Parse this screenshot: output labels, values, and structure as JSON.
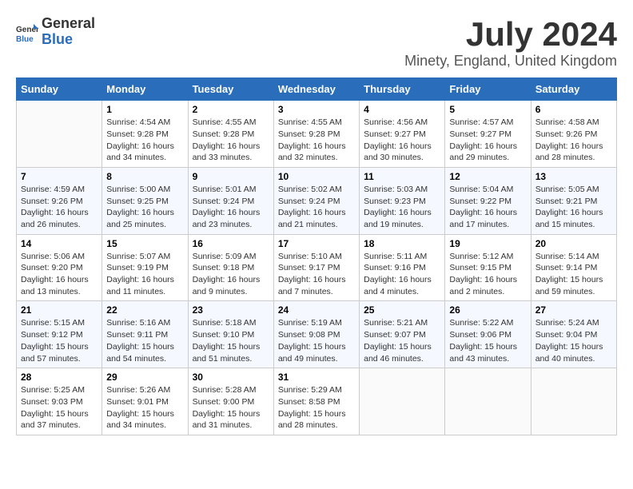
{
  "logo": {
    "general": "General",
    "blue": "Blue"
  },
  "title": "July 2024",
  "location": "Minety, England, United Kingdom",
  "days_header": [
    "Sunday",
    "Monday",
    "Tuesday",
    "Wednesday",
    "Thursday",
    "Friday",
    "Saturday"
  ],
  "weeks": [
    [
      {
        "day": "",
        "sunrise": "",
        "sunset": "",
        "daylight": ""
      },
      {
        "day": "1",
        "sunrise": "Sunrise: 4:54 AM",
        "sunset": "Sunset: 9:28 PM",
        "daylight": "Daylight: 16 hours and 34 minutes."
      },
      {
        "day": "2",
        "sunrise": "Sunrise: 4:55 AM",
        "sunset": "Sunset: 9:28 PM",
        "daylight": "Daylight: 16 hours and 33 minutes."
      },
      {
        "day": "3",
        "sunrise": "Sunrise: 4:55 AM",
        "sunset": "Sunset: 9:28 PM",
        "daylight": "Daylight: 16 hours and 32 minutes."
      },
      {
        "day": "4",
        "sunrise": "Sunrise: 4:56 AM",
        "sunset": "Sunset: 9:27 PM",
        "daylight": "Daylight: 16 hours and 30 minutes."
      },
      {
        "day": "5",
        "sunrise": "Sunrise: 4:57 AM",
        "sunset": "Sunset: 9:27 PM",
        "daylight": "Daylight: 16 hours and 29 minutes."
      },
      {
        "day": "6",
        "sunrise": "Sunrise: 4:58 AM",
        "sunset": "Sunset: 9:26 PM",
        "daylight": "Daylight: 16 hours and 28 minutes."
      }
    ],
    [
      {
        "day": "7",
        "sunrise": "Sunrise: 4:59 AM",
        "sunset": "Sunset: 9:26 PM",
        "daylight": "Daylight: 16 hours and 26 minutes."
      },
      {
        "day": "8",
        "sunrise": "Sunrise: 5:00 AM",
        "sunset": "Sunset: 9:25 PM",
        "daylight": "Daylight: 16 hours and 25 minutes."
      },
      {
        "day": "9",
        "sunrise": "Sunrise: 5:01 AM",
        "sunset": "Sunset: 9:24 PM",
        "daylight": "Daylight: 16 hours and 23 minutes."
      },
      {
        "day": "10",
        "sunrise": "Sunrise: 5:02 AM",
        "sunset": "Sunset: 9:24 PM",
        "daylight": "Daylight: 16 hours and 21 minutes."
      },
      {
        "day": "11",
        "sunrise": "Sunrise: 5:03 AM",
        "sunset": "Sunset: 9:23 PM",
        "daylight": "Daylight: 16 hours and 19 minutes."
      },
      {
        "day": "12",
        "sunrise": "Sunrise: 5:04 AM",
        "sunset": "Sunset: 9:22 PM",
        "daylight": "Daylight: 16 hours and 17 minutes."
      },
      {
        "day": "13",
        "sunrise": "Sunrise: 5:05 AM",
        "sunset": "Sunset: 9:21 PM",
        "daylight": "Daylight: 16 hours and 15 minutes."
      }
    ],
    [
      {
        "day": "14",
        "sunrise": "Sunrise: 5:06 AM",
        "sunset": "Sunset: 9:20 PM",
        "daylight": "Daylight: 16 hours and 13 minutes."
      },
      {
        "day": "15",
        "sunrise": "Sunrise: 5:07 AM",
        "sunset": "Sunset: 9:19 PM",
        "daylight": "Daylight: 16 hours and 11 minutes."
      },
      {
        "day": "16",
        "sunrise": "Sunrise: 5:09 AM",
        "sunset": "Sunset: 9:18 PM",
        "daylight": "Daylight: 16 hours and 9 minutes."
      },
      {
        "day": "17",
        "sunrise": "Sunrise: 5:10 AM",
        "sunset": "Sunset: 9:17 PM",
        "daylight": "Daylight: 16 hours and 7 minutes."
      },
      {
        "day": "18",
        "sunrise": "Sunrise: 5:11 AM",
        "sunset": "Sunset: 9:16 PM",
        "daylight": "Daylight: 16 hours and 4 minutes."
      },
      {
        "day": "19",
        "sunrise": "Sunrise: 5:12 AM",
        "sunset": "Sunset: 9:15 PM",
        "daylight": "Daylight: 16 hours and 2 minutes."
      },
      {
        "day": "20",
        "sunrise": "Sunrise: 5:14 AM",
        "sunset": "Sunset: 9:14 PM",
        "daylight": "Daylight: 15 hours and 59 minutes."
      }
    ],
    [
      {
        "day": "21",
        "sunrise": "Sunrise: 5:15 AM",
        "sunset": "Sunset: 9:12 PM",
        "daylight": "Daylight: 15 hours and 57 minutes."
      },
      {
        "day": "22",
        "sunrise": "Sunrise: 5:16 AM",
        "sunset": "Sunset: 9:11 PM",
        "daylight": "Daylight: 15 hours and 54 minutes."
      },
      {
        "day": "23",
        "sunrise": "Sunrise: 5:18 AM",
        "sunset": "Sunset: 9:10 PM",
        "daylight": "Daylight: 15 hours and 51 minutes."
      },
      {
        "day": "24",
        "sunrise": "Sunrise: 5:19 AM",
        "sunset": "Sunset: 9:08 PM",
        "daylight": "Daylight: 15 hours and 49 minutes."
      },
      {
        "day": "25",
        "sunrise": "Sunrise: 5:21 AM",
        "sunset": "Sunset: 9:07 PM",
        "daylight": "Daylight: 15 hours and 46 minutes."
      },
      {
        "day": "26",
        "sunrise": "Sunrise: 5:22 AM",
        "sunset": "Sunset: 9:06 PM",
        "daylight": "Daylight: 15 hours and 43 minutes."
      },
      {
        "day": "27",
        "sunrise": "Sunrise: 5:24 AM",
        "sunset": "Sunset: 9:04 PM",
        "daylight": "Daylight: 15 hours and 40 minutes."
      }
    ],
    [
      {
        "day": "28",
        "sunrise": "Sunrise: 5:25 AM",
        "sunset": "Sunset: 9:03 PM",
        "daylight": "Daylight: 15 hours and 37 minutes."
      },
      {
        "day": "29",
        "sunrise": "Sunrise: 5:26 AM",
        "sunset": "Sunset: 9:01 PM",
        "daylight": "Daylight: 15 hours and 34 minutes."
      },
      {
        "day": "30",
        "sunrise": "Sunrise: 5:28 AM",
        "sunset": "Sunset: 9:00 PM",
        "daylight": "Daylight: 15 hours and 31 minutes."
      },
      {
        "day": "31",
        "sunrise": "Sunrise: 5:29 AM",
        "sunset": "Sunset: 8:58 PM",
        "daylight": "Daylight: 15 hours and 28 minutes."
      },
      {
        "day": "",
        "sunrise": "",
        "sunset": "",
        "daylight": ""
      },
      {
        "day": "",
        "sunrise": "",
        "sunset": "",
        "daylight": ""
      },
      {
        "day": "",
        "sunrise": "",
        "sunset": "",
        "daylight": ""
      }
    ]
  ]
}
